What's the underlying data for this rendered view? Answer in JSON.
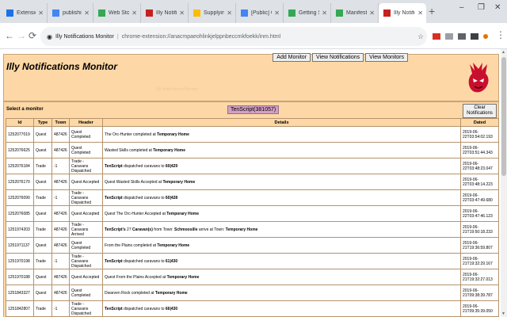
{
  "browser": {
    "tabs": [
      {
        "title": "Extensions",
        "fav": "#1a73e8",
        "active": false
      },
      {
        "title": "publishing",
        "fav": "#4285f4",
        "active": false
      },
      {
        "title": "Web Store",
        "fav": "#34a853",
        "active": false
      },
      {
        "title": "Illy Notific",
        "fav": "#c5221f",
        "active": false
      },
      {
        "title": "Supplying",
        "fav": "#fbbc04",
        "active": false
      },
      {
        "title": "[Public] Ch",
        "fav": "#4285f4",
        "active": false
      },
      {
        "title": "Getting Sta",
        "fav": "#34a853",
        "active": false
      },
      {
        "title": "Manifest -",
        "fav": "#34a853",
        "active": false
      },
      {
        "title": "Illy Notific",
        "fav": "#c5221f",
        "active": true
      }
    ],
    "new_tab": "+",
    "omnibox": {
      "page_name": "Illy Notifications Monitor",
      "url": "chrome-extension://anacmpaeohlinkjelppnbeccmkfoekk/inm.html"
    }
  },
  "nav": {
    "add_monitor": "Add Monitor",
    "view_notifications": "View Notifications",
    "view_monitors": "View Monitors"
  },
  "header": {
    "title": "Illy Notifications Monitor",
    "faint_text": "Illy Notifications Monitor"
  },
  "selector": {
    "label": "Select a monitor",
    "current_monitor": "TenScript(381057)",
    "clear_button": "Clear Notifications"
  },
  "table": {
    "headers": [
      "Id",
      "Type",
      "Town",
      "Header",
      "Details",
      "Dated"
    ],
    "rows": [
      {
        "id": "1252077019",
        "type": "Quest",
        "town": "487426",
        "header": "Quest Completed",
        "details": [
          {
            "t": "The Orc-Hunter completed at ",
            "b": false
          },
          {
            "t": "Temporary Home",
            "b": true
          }
        ],
        "dated": "2019-06-22T03:54:02.193"
      },
      {
        "id": "1252076625",
        "type": "Quest",
        "town": "487426",
        "header": "Quest Completed",
        "details": [
          {
            "t": "Wasted Skills completed at ",
            "b": false
          },
          {
            "t": "Temporary Home",
            "b": true
          }
        ],
        "dated": "2019-06-22T03:51:44.343"
      },
      {
        "id": "1252076184",
        "type": "Trade",
        "town": "-1",
        "header": "Trade - Caravans Dispatched",
        "details": [
          {
            "t": "TenScript",
            "b": true
          },
          {
            "t": " dispatched caravans to ",
            "b": false
          },
          {
            "t": "60|429",
            "b": true
          }
        ],
        "dated": "2019-06-22T03:48:23.047"
      },
      {
        "id": "1252076170",
        "type": "Quest",
        "town": "487426",
        "header": "Quest Accepted",
        "details": [
          {
            "t": "Quest Wasted Skills Accepted at ",
            "b": false
          },
          {
            "t": "Temporary Home",
            "b": true
          }
        ],
        "dated": "2019-06-22T03:48:14.223"
      },
      {
        "id": "1252076090",
        "type": "Trade",
        "town": "-1",
        "header": "Trade - Caravans Dispatched",
        "details": [
          {
            "t": "TenScript",
            "b": true
          },
          {
            "t": " dispatched caravans to ",
            "b": false
          },
          {
            "t": "60|428",
            "b": true
          }
        ],
        "dated": "2019-06-22T03:47:49.680"
      },
      {
        "id": "1252076085",
        "type": "Quest",
        "town": "487426",
        "header": "Quest Accepted",
        "details": [
          {
            "t": "Quest The Orc-Hunter Accepted at ",
            "b": false
          },
          {
            "t": "Temporary Home",
            "b": true
          }
        ],
        "dated": "2019-06-22T03:47:46.123"
      },
      {
        "id": "1251974203",
        "type": "Trade",
        "town": "487426",
        "header": "Trade - Caravans Arrived",
        "details": [
          {
            "t": "TenScript's",
            "b": true
          },
          {
            "t": " 27 ",
            "b": false
          },
          {
            "t": "Caravan(s)",
            "b": true
          },
          {
            "t": " from Town: ",
            "b": false
          },
          {
            "t": "Schmoosille",
            "b": true
          },
          {
            "t": " arrive at Town: ",
            "b": false
          },
          {
            "t": "Temporary Home",
            "b": true
          }
        ],
        "dated": "2019-06-21T19:50:18.233"
      },
      {
        "id": "1251971137",
        "type": "Quest",
        "town": "487426",
        "header": "Quest Completed",
        "details": [
          {
            "t": "From the Plains completed at ",
            "b": false
          },
          {
            "t": "Temporary Home",
            "b": true
          }
        ],
        "dated": "2019-06-21T19:36:59.807"
      },
      {
        "id": "1251970198",
        "type": "Trade",
        "town": "-1",
        "header": "Trade - Caravans Dispatched",
        "details": [
          {
            "t": "TenScript",
            "b": true
          },
          {
            "t": " dispatched caravans to ",
            "b": false
          },
          {
            "t": "61|430",
            "b": true
          }
        ],
        "dated": "2019-06-21T19:32:29.167"
      },
      {
        "id": "1251970188",
        "type": "Quest",
        "town": "487426",
        "header": "Quest Accepted",
        "details": [
          {
            "t": "Quest From the Plains Accepted at ",
            "b": false
          },
          {
            "t": "Temporary Home",
            "b": true
          }
        ],
        "dated": "2019-06-21T19:32:27.013"
      },
      {
        "id": "1251843327",
        "type": "Quest",
        "town": "487426",
        "header": "Quest Completed",
        "details": [
          {
            "t": "Dwarven Rock completed at ",
            "b": false
          },
          {
            "t": "Temporary Home",
            "b": true
          }
        ],
        "dated": "2019-06-21T09:38:39.787"
      },
      {
        "id": "1251842807",
        "type": "Trade",
        "town": "-1",
        "header": "Trade - Caravans Dispatched",
        "details": [
          {
            "t": "TenScript",
            "b": true
          },
          {
            "t": " dispatched caravans to ",
            "b": false
          },
          {
            "t": "66|430",
            "b": true
          }
        ],
        "dated": "2019-06-21T09:35:39.050"
      }
    ]
  },
  "colors": {
    "panel": "#fdd8a6",
    "panel_border": "#c7a47a",
    "pill": "#d39fc2",
    "mascot": "#c8102e"
  },
  "icons": {
    "back": "back-arrow-icon",
    "forward": "forward-arrow-icon",
    "reload": "reload-icon",
    "info": "page-info-icon",
    "star": "bookmark-star-icon",
    "menu": "kebab-menu-icon",
    "mascot": "red-dragon-logo-icon"
  }
}
